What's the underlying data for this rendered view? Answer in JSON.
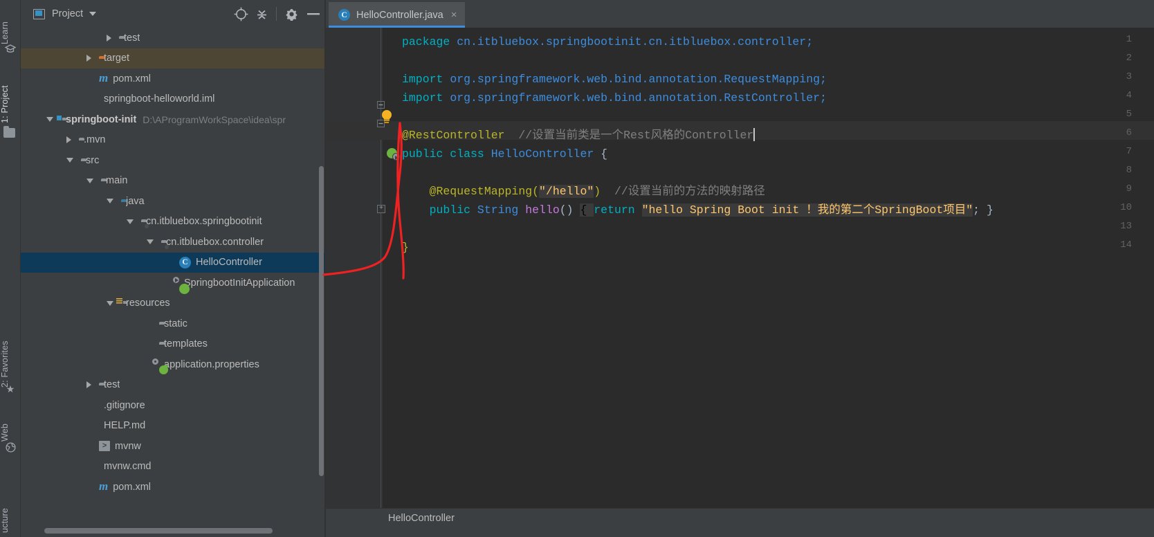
{
  "window": {
    "theme": "darcula",
    "accent": "#3d8ddf"
  },
  "left_rail": {
    "items": [
      {
        "label": "Learn",
        "icon": "graduation-cap-icon",
        "selected": false
      },
      {
        "label": "1: Project",
        "icon": "project-folder-icon",
        "selected": true
      },
      {
        "label": "2: Favorites",
        "icon": "star-icon",
        "selected": false
      },
      {
        "label": "Web",
        "icon": "globe-icon",
        "selected": false
      },
      {
        "label": "ucture",
        "icon": "structure-icon",
        "selected": false
      }
    ]
  },
  "project_panel": {
    "title": "Project",
    "title_icon": "project-view-icon",
    "actions": [
      {
        "name": "locate-icon",
        "glyph": "locate"
      },
      {
        "name": "collapse-all-icon",
        "glyph": "collapse"
      },
      {
        "name": "gear-icon",
        "glyph": "gear"
      },
      {
        "name": "hide-icon",
        "glyph": "minus"
      }
    ],
    "tree": [
      {
        "label": "test",
        "icon": "folder-icon",
        "indent": 4,
        "arrow": "closed",
        "state": "normal"
      },
      {
        "label": "target",
        "icon": "folder-orange-icon",
        "indent": 3,
        "arrow": "closed",
        "state": "highlighted"
      },
      {
        "label": "pom.xml",
        "icon": "maven-icon",
        "indent": 3,
        "arrow": "none",
        "state": "normal"
      },
      {
        "label": "springboot-helloworld.iml",
        "icon": "iml-file-icon",
        "indent": 3,
        "arrow": "none",
        "state": "normal"
      },
      {
        "label": "springboot-init",
        "icon": "module-folder-icon",
        "indent": 1,
        "arrow": "open",
        "state": "normal",
        "bold": true,
        "hint": "D:\\AProgramWorkSpace\\idea\\spr"
      },
      {
        "label": ".mvn",
        "icon": "folder-icon",
        "indent": 2,
        "arrow": "closed",
        "state": "normal"
      },
      {
        "label": "src",
        "icon": "folder-icon",
        "indent": 2,
        "arrow": "open",
        "state": "normal"
      },
      {
        "label": "main",
        "icon": "folder-icon",
        "indent": 3,
        "arrow": "open",
        "state": "normal"
      },
      {
        "label": "java",
        "icon": "folder-source-icon",
        "indent": 4,
        "arrow": "open",
        "state": "normal"
      },
      {
        "label": "cn.itbluebox.springbootinit",
        "icon": "package-icon",
        "indent": 5,
        "arrow": "open",
        "state": "normal"
      },
      {
        "label": "cn.itbluebox.controller",
        "icon": "package-icon",
        "indent": 6,
        "arrow": "open",
        "state": "normal"
      },
      {
        "label": "HelloController",
        "icon": "java-class-icon",
        "indent": 7,
        "arrow": "none",
        "state": "selected"
      },
      {
        "label": "SpringbootInitApplication",
        "icon": "spring-boot-class-icon",
        "indent": 7,
        "arrow": "none",
        "state": "normal"
      },
      {
        "label": "resources",
        "icon": "folder-resources-icon",
        "indent": 4,
        "arrow": "open",
        "state": "normal"
      },
      {
        "label": "static",
        "icon": "folder-icon",
        "indent": 6,
        "arrow": "none",
        "state": "normal"
      },
      {
        "label": "templates",
        "icon": "folder-icon",
        "indent": 6,
        "arrow": "none",
        "state": "normal"
      },
      {
        "label": "application.properties",
        "icon": "spring-properties-icon",
        "indent": 6,
        "arrow": "none",
        "state": "normal"
      },
      {
        "label": "test",
        "icon": "folder-icon",
        "indent": 3,
        "arrow": "closed",
        "state": "normal"
      },
      {
        "label": ".gitignore",
        "icon": "gitignore-file-icon",
        "indent": 3,
        "arrow": "none",
        "state": "normal"
      },
      {
        "label": "HELP.md",
        "icon": "markdown-file-icon",
        "indent": 3,
        "arrow": "none",
        "state": "normal"
      },
      {
        "label": "mvnw",
        "icon": "shell-script-icon",
        "indent": 3,
        "arrow": "none",
        "state": "normal"
      },
      {
        "label": "mvnw.cmd",
        "icon": "cmd-script-icon",
        "indent": 3,
        "arrow": "none",
        "state": "normal"
      },
      {
        "label": "pom.xml",
        "icon": "maven-icon",
        "indent": 3,
        "arrow": "none",
        "state": "normal"
      }
    ]
  },
  "editor": {
    "tab": {
      "label": "HelloController.java",
      "icon": "java-class-icon",
      "close_glyph": "×",
      "active": true
    },
    "gutter_numbers": [
      "1",
      "2",
      "3",
      "4",
      "5",
      "6",
      "7",
      "8",
      "9",
      "10",
      "13",
      "14"
    ],
    "lines": [
      {
        "num": "1",
        "segments": [
          {
            "t": "package ",
            "c": "kw2"
          },
          {
            "t": "cn.itbluebox.springbootinit.cn.itbluebox.controller;",
            "c": "pkgc"
          }
        ]
      },
      {
        "num": "2",
        "segments": []
      },
      {
        "num": "3",
        "segments": [
          {
            "t": "import ",
            "c": "kw2"
          },
          {
            "t": "org.springframework.web.bind.annotation.RequestMapping;",
            "c": "pkgc"
          }
        ]
      },
      {
        "num": "4",
        "segments": [
          {
            "t": "import ",
            "c": "kw2"
          },
          {
            "t": "org.springframework.web.bind.annotation.RestController;",
            "c": "pkgc"
          }
        ]
      },
      {
        "num": "5",
        "segments": []
      },
      {
        "num": "6",
        "segments": [
          {
            "t": "@RestController",
            "c": "ann"
          },
          {
            "t": "  ",
            "c": "plain"
          },
          {
            "t": "//设置当前类是一个Rest风格的Controller",
            "c": "cmt"
          }
        ]
      },
      {
        "num": "7",
        "segments": [
          {
            "t": "public class ",
            "c": "kw2"
          },
          {
            "t": "HelloController",
            "c": "cls"
          },
          {
            "t": " {",
            "c": "plain"
          }
        ]
      },
      {
        "num": "8",
        "segments": []
      },
      {
        "num": "9",
        "segments": [
          {
            "t": "    @RequestMapping(",
            "c": "ann"
          },
          {
            "t": "\"/hello\"",
            "c": "str"
          },
          {
            "t": ")",
            "c": "ann"
          },
          {
            "t": "  ",
            "c": "plain"
          },
          {
            "t": "//设置当前的方法的映射路径",
            "c": "cmt"
          }
        ]
      },
      {
        "num": "10",
        "segments": [
          {
            "t": "    public ",
            "c": "kw2"
          },
          {
            "t": "String ",
            "c": "cls"
          },
          {
            "t": "hello",
            "c": "mth"
          },
          {
            "t": "() ",
            "c": "plain"
          },
          {
            "t": "{ ",
            "c": "hl"
          },
          {
            "t": "return ",
            "c": "kw2"
          },
          {
            "t": "\"hello Spring Boot init ！我的第二个SpringBoot项目\"",
            "c": "str"
          },
          {
            "t": "; }",
            "c": "plain"
          }
        ]
      },
      {
        "num": "13",
        "segments": []
      },
      {
        "num": "14",
        "segments": [
          {
            "t": "}",
            "c": "ann"
          }
        ]
      }
    ],
    "intention_bulb": "lightbulb-icon",
    "run_marker": "spring-run-gutter-icon",
    "breadcrumb": "HelloController"
  },
  "annotation": {
    "type": "red-curve-arrow",
    "color": "#ee2222",
    "describes": "hand-drawn red arrow pointing from HelloController tree node to code"
  }
}
